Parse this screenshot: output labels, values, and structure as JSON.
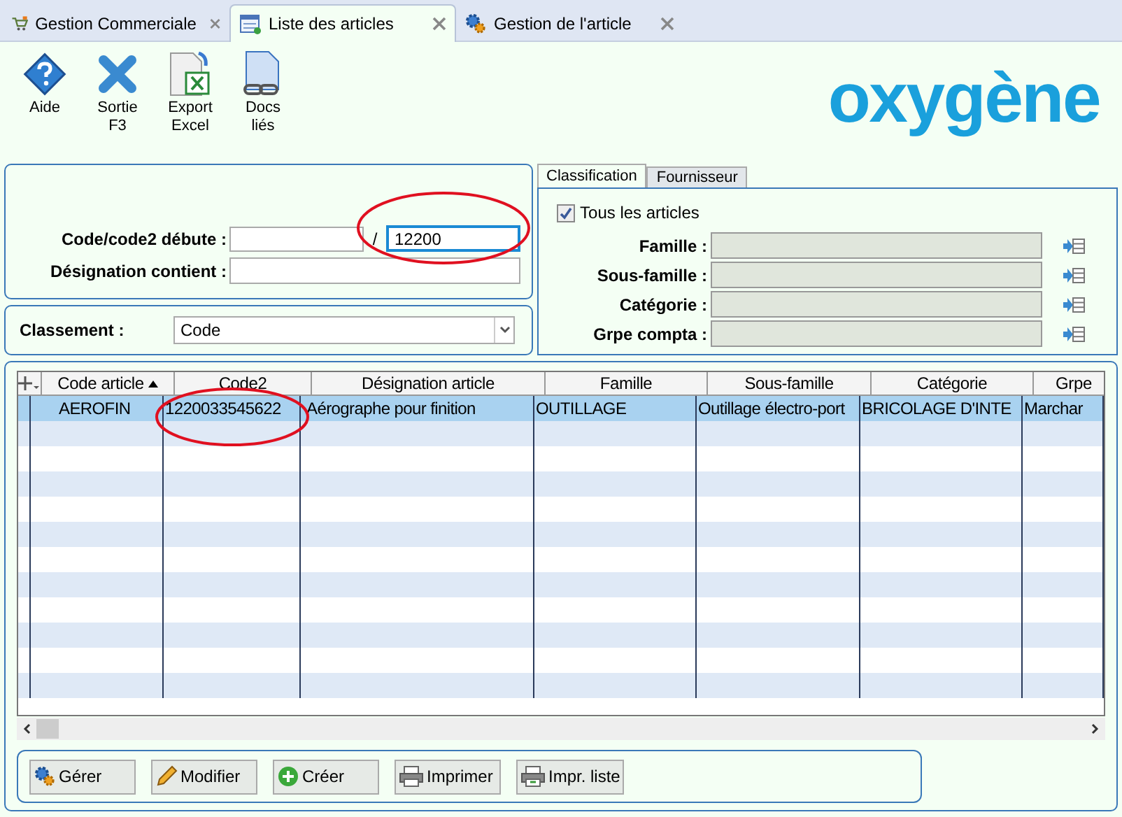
{
  "tabs": [
    {
      "label": "Gestion Commerciale",
      "selected": false
    },
    {
      "label": "Liste des articles",
      "selected": true
    },
    {
      "label": "Gestion de l'article",
      "selected": false
    }
  ],
  "toolbar": [
    {
      "lines": [
        "Aide"
      ]
    },
    {
      "lines": [
        "Sortie",
        "F3"
      ]
    },
    {
      "lines": [
        "Export",
        "Excel"
      ]
    },
    {
      "lines": [
        "Docs",
        "liés"
      ]
    }
  ],
  "logo": "oxygène",
  "filters": {
    "code_label": "Code/code2 débute :",
    "separator": "/",
    "code2_value": "12200",
    "designation_label": "Désignation contient :"
  },
  "sort": {
    "label": "Classement :",
    "value": "Code"
  },
  "side_tabs": [
    {
      "label": "Classification",
      "selected": true
    },
    {
      "label": "Fournisseur",
      "selected": false
    }
  ],
  "all_articles": {
    "label": "Tous les articles",
    "checked": true
  },
  "classification_fields": [
    {
      "label": "Famille :"
    },
    {
      "label": "Sous-famille :"
    },
    {
      "label": "Catégorie :"
    },
    {
      "label": "Grpe compta :"
    }
  ],
  "table": {
    "columns": [
      {
        "label": "Code article",
        "sorted": true
      },
      {
        "label": "Code2",
        "sorted": false
      },
      {
        "label": "Désignation article",
        "sorted": false
      },
      {
        "label": "Famille",
        "sorted": false
      },
      {
        "label": "Sous-famille",
        "sorted": false
      },
      {
        "label": "Catégorie",
        "sorted": false
      },
      {
        "label": "Grpe",
        "sorted": false
      }
    ],
    "rows": [
      {
        "selected": true,
        "cells": [
          "AEROFIN",
          "1220033545622",
          "Aérographe pour finition",
          "OUTILLAGE",
          "Outillage électro-port",
          "BRICOLAGE D'INTE",
          "Marchar"
        ]
      }
    ]
  },
  "buttons": [
    {
      "label": "Gérer"
    },
    {
      "label": "Modifier"
    },
    {
      "label": "Créer"
    },
    {
      "label": "Imprimer"
    },
    {
      "label": "Impr. liste"
    }
  ]
}
